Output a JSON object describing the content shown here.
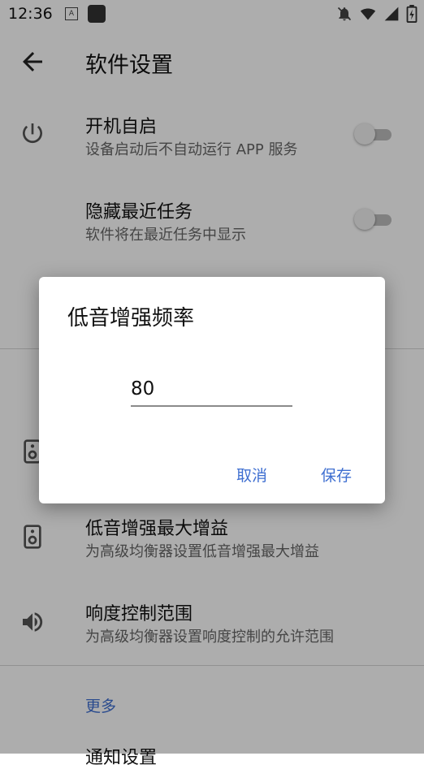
{
  "status_bar": {
    "time": "12:36",
    "notif_letter": "A",
    "icons": [
      "notifications-off-icon",
      "wifi-icon",
      "signal-icon",
      "battery-charging-icon"
    ]
  },
  "app_bar": {
    "title": "软件设置",
    "back_icon": "arrow-back-icon"
  },
  "settings": [
    {
      "title": "开机自启",
      "subtitle": "设备启动后不自动运行 APP 服务",
      "icon": "power-icon",
      "toggle": false
    },
    {
      "title": "隐藏最近任务",
      "subtitle": "软件将在最近任务中显示",
      "icon": null,
      "toggle": false
    },
    {
      "title": "低音增强最大增益",
      "subtitle": "为高级均衡器设置低音增强最大增益",
      "icon": "speaker-icon"
    },
    {
      "title": "响度控制范围",
      "subtitle": "为高级均衡器设置响度控制的允许范围",
      "icon": "volume-icon"
    }
  ],
  "section_more": "更多",
  "next_item_title": "通知设置",
  "dialog": {
    "title": "低音增强频率",
    "input_value": "80",
    "cancel": "取消",
    "save": "保存"
  },
  "colors": {
    "accent": "#3f6fd1",
    "scrim": "rgba(0,0,0,0.32)"
  }
}
